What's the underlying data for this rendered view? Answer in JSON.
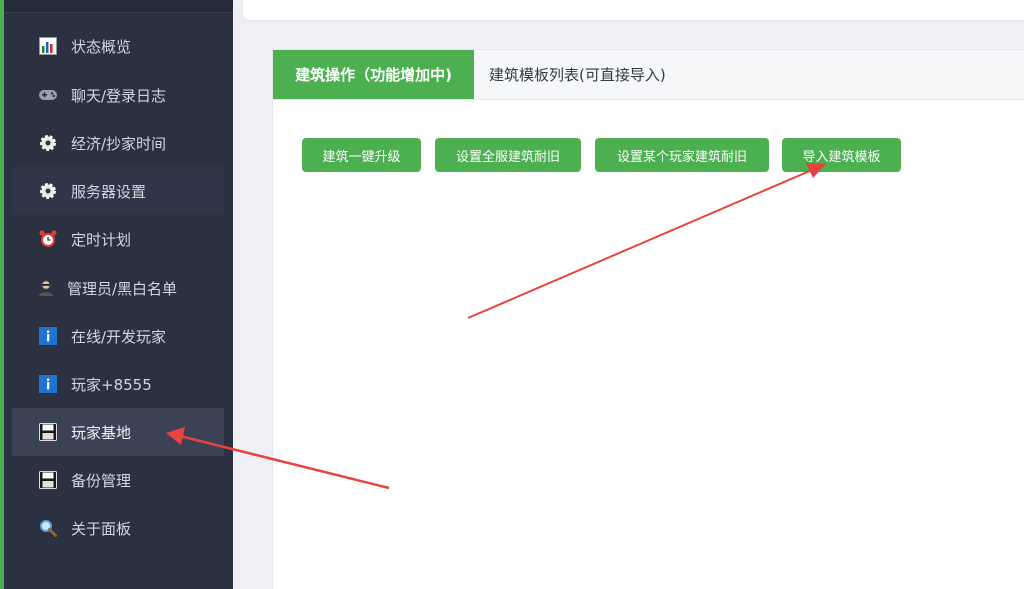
{
  "sidebar": {
    "items": [
      {
        "label": "状态概览",
        "icon": "bar-chart-icon"
      },
      {
        "label": "聊天/登录日志",
        "icon": "gamepad-icon"
      },
      {
        "label": "经济/抄家时间",
        "icon": "gear-icon"
      },
      {
        "label": "服务器设置",
        "icon": "gear-icon"
      },
      {
        "label": "定时计划",
        "icon": "alarm-clock-icon"
      },
      {
        "label": "管理员/黑白名单",
        "icon": "admin-user-icon"
      },
      {
        "label": "在线/开发玩家",
        "icon": "info-icon"
      },
      {
        "label": "玩家+8555",
        "icon": "info-icon"
      },
      {
        "label": "玩家基地",
        "icon": "floppy-disk-icon"
      },
      {
        "label": "备份管理",
        "icon": "floppy-disk-icon"
      },
      {
        "label": "关于面板",
        "icon": "magnifier-icon"
      }
    ],
    "active_item": "玩家基地"
  },
  "tabs": {
    "active": "建筑操作（功能增加中)",
    "inactive": "建筑模板列表(可直接导入)"
  },
  "buttons": {
    "upgrade": "建筑一键升级",
    "set_all_durability": "设置全服建筑耐旧",
    "set_player_durability": "设置某个玩家建筑耐旧",
    "import_template": "导入建筑模板"
  },
  "colors": {
    "accent": "#4caf50",
    "sidebar_bg": "#2c3142",
    "arrow": "#e8433f"
  }
}
